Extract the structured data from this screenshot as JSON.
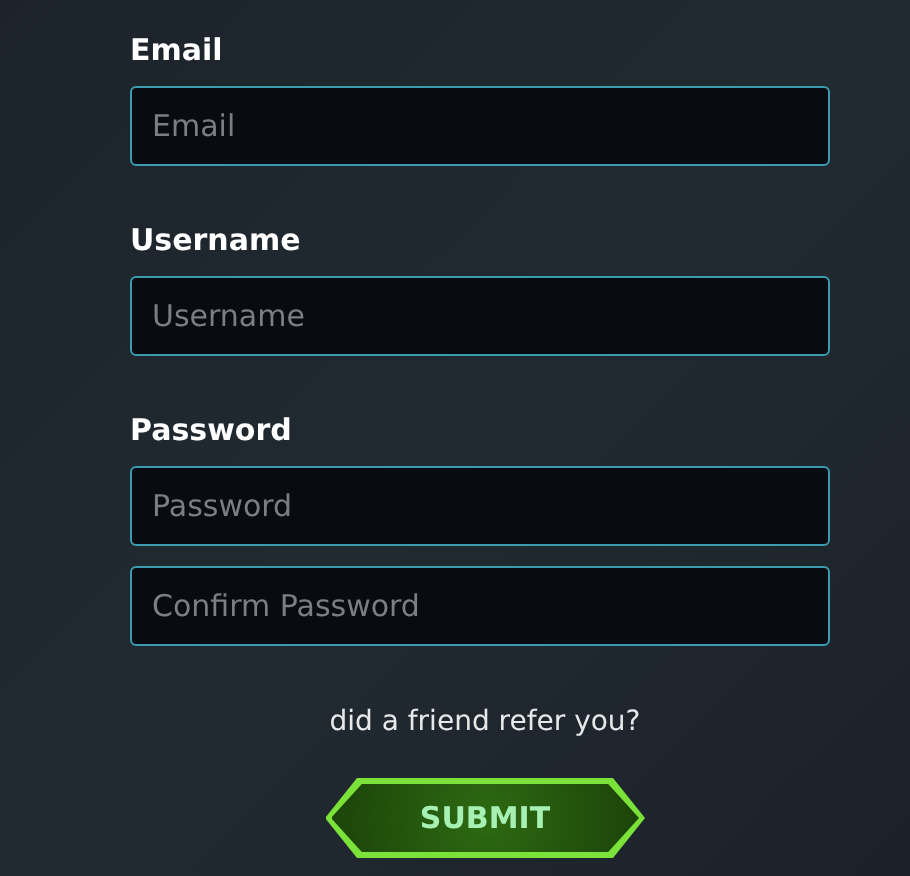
{
  "groups": [
    {
      "label": "Email",
      "fields": [
        {
          "placeholder": "Email"
        }
      ]
    },
    {
      "label": "Username",
      "fields": [
        {
          "placeholder": "Username"
        }
      ]
    },
    {
      "label": "Password",
      "fields": [
        {
          "placeholder": "Password"
        },
        {
          "placeholder": "Confirm Password"
        }
      ]
    }
  ],
  "referral_link": "did a friend refer you?",
  "submit_button": "SUBMIT"
}
